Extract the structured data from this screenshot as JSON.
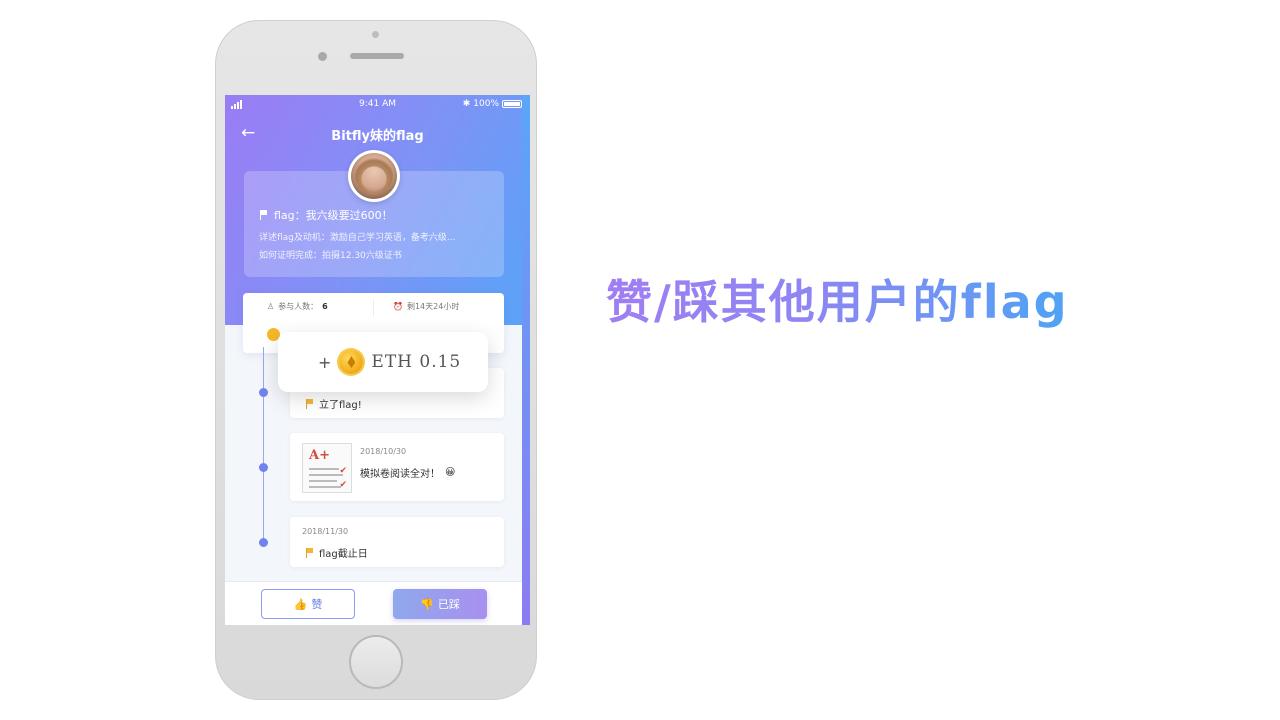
{
  "status_bar": {
    "time": "9:41 AM",
    "battery": "100%"
  },
  "header": {
    "title": "Bitfly妹的flag"
  },
  "flag_card": {
    "flag_title": "flag：我六级要过600！",
    "motivation": "详述flag及动机：激励自己学习英语，备考六级...",
    "proof": "如何证明完成：拍摄12.30六级证书"
  },
  "stats": {
    "participants_label": "参与人数：",
    "participants_value": "6",
    "time_left": "剩14天24小时"
  },
  "timeline": [
    {
      "text": "立了flag!"
    },
    {
      "date": "2018/10/30",
      "text": "模拟卷阅读全对！"
    },
    {
      "date": "2018/11/30",
      "text": "flag截止日"
    }
  ],
  "popup": {
    "plus": "+",
    "amount": "ETH 0.15"
  },
  "actions": {
    "like_label": "赞",
    "trampled_label": "已踩"
  },
  "slogan": "赞/踩其他用户的flag",
  "colors": {
    "accent_purple": "#9b7cf5",
    "accent_blue": "#4ea9f8"
  }
}
